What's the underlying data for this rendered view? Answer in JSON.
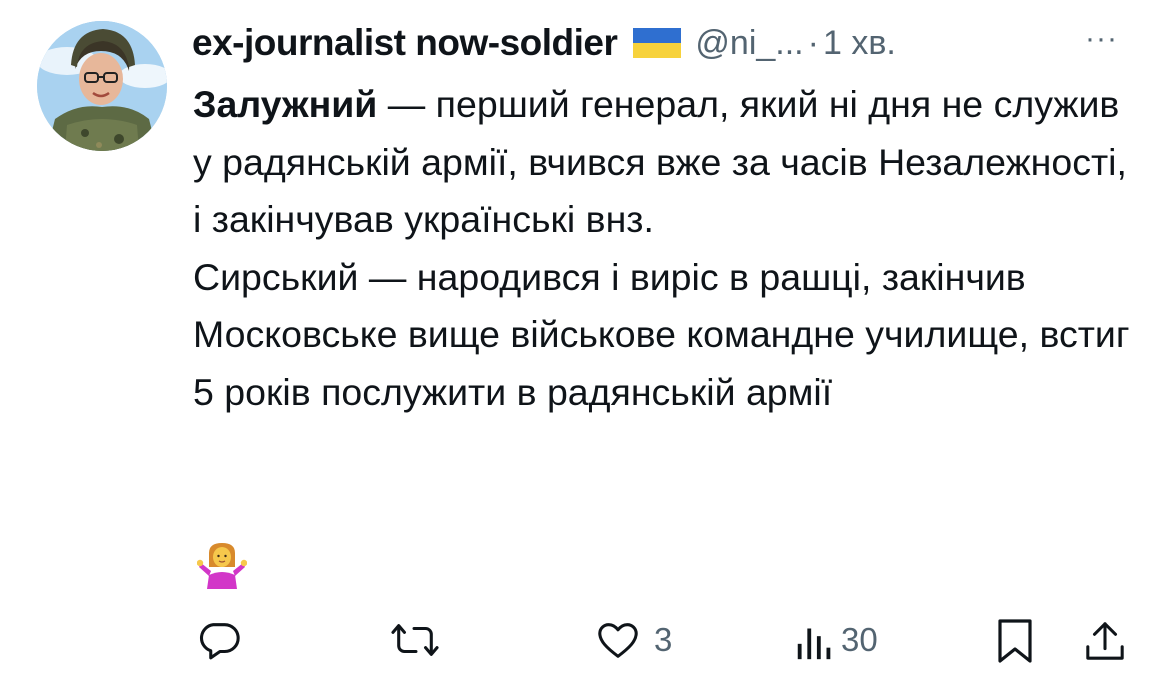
{
  "post": {
    "author_name": "ex-journalist now-soldier",
    "author_flag": "ukraine-flag",
    "handle": "@ni_...",
    "separator": "·",
    "time": "1 хв.",
    "more": "···",
    "text_bold": "Залужний",
    "paragraph1_rest": " — перший генерал, який ні дня не служив у радянській армії, вчився вже за часів Незалежності, і закінчував українські внз.",
    "paragraph2": "Сирський — народився і виріс в рашці, закінчив Московське вище військове командне училище, встиг 5 років послужити в радянській армії",
    "emoji": "woman-shrugging-emoji"
  },
  "actions": {
    "reply_icon": "reply-icon",
    "repost_icon": "repost-icon",
    "like_icon": "heart-icon",
    "like_count": "3",
    "views_icon": "views-icon",
    "views_count": "30",
    "bookmark_icon": "bookmark-icon",
    "share_icon": "share-icon"
  },
  "colors": {
    "text": "#0f1419",
    "secondary": "#536471",
    "flag_blue": "#2f6fd0",
    "flag_yellow": "#f7d23c"
  }
}
